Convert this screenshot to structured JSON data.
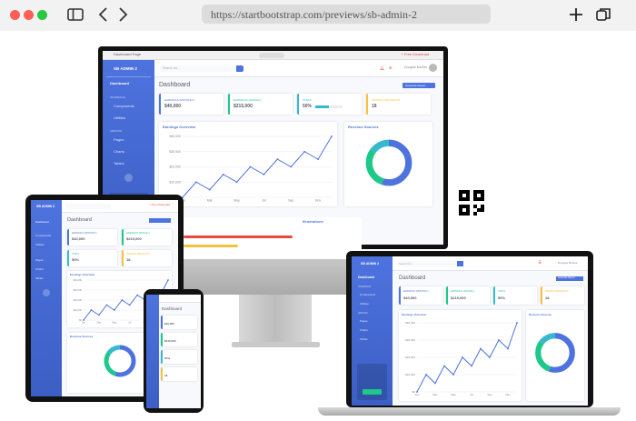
{
  "browser": {
    "url": "https://startbootstrap.com/previews/sb-admin-2"
  },
  "colors": {
    "primary": "#4e73df",
    "success": "#1cc88a",
    "info": "#36b9cc",
    "warning": "#f6c23e",
    "danger": "#e74a3b"
  },
  "admin": {
    "brand": "SB ADMIN 2",
    "tab": "Dashboard Page",
    "search_placeholder": "Search for...",
    "download": "+ Free Download",
    "user": "Douglas McGee",
    "nav": {
      "dashboard": "Dashboard",
      "interface": "INTERFACE",
      "components": "Components",
      "utilities": "Utilities",
      "addons": "ADDONS",
      "pages": "Pages",
      "charts": "Charts",
      "tables": "Tables"
    },
    "page_title": "Dashboard",
    "report_btn": "Generate Report",
    "cards": [
      {
        "label": "EARNINGS (MONTHLY)",
        "value": "$40,000"
      },
      {
        "label": "EARNINGS (ANNUAL)",
        "value": "$215,000"
      },
      {
        "label": "TASKS",
        "value": "50%"
      },
      {
        "label": "PENDING REQUESTS",
        "value": "18"
      }
    ],
    "earnings_title": "Earnings Overview",
    "revenue_title": "Revenue Sources",
    "illustrations_title": "Illustrations",
    "legend": [
      "Direct",
      "Social",
      "Referral"
    ],
    "sidebar_note": "SB Admin Pro is packed with premium features, components, and more!",
    "upgrade": "Upgrade to Pro!"
  },
  "chart_data": {
    "type": "line",
    "title": "Earnings Overview",
    "x": [
      "Jan",
      "Feb",
      "Mar",
      "Apr",
      "May",
      "Jun",
      "Jul",
      "Aug",
      "Sep",
      "Oct",
      "Nov",
      "Dec"
    ],
    "series": [
      {
        "values": [
          0,
          10000,
          5000,
          15000,
          10000,
          20000,
          15000,
          25000,
          20000,
          30000,
          25000,
          40000
        ]
      }
    ],
    "ylim": [
      0,
      40000
    ],
    "y_ticks": [
      "$0",
      "$10,000",
      "$20,000",
      "$30,000",
      "$40,000"
    ]
  },
  "revenue_data": {
    "type": "pie",
    "values": [
      55,
      30,
      15
    ],
    "colors": [
      "#4e73df",
      "#1cc88a",
      "#36b9cc"
    ]
  }
}
